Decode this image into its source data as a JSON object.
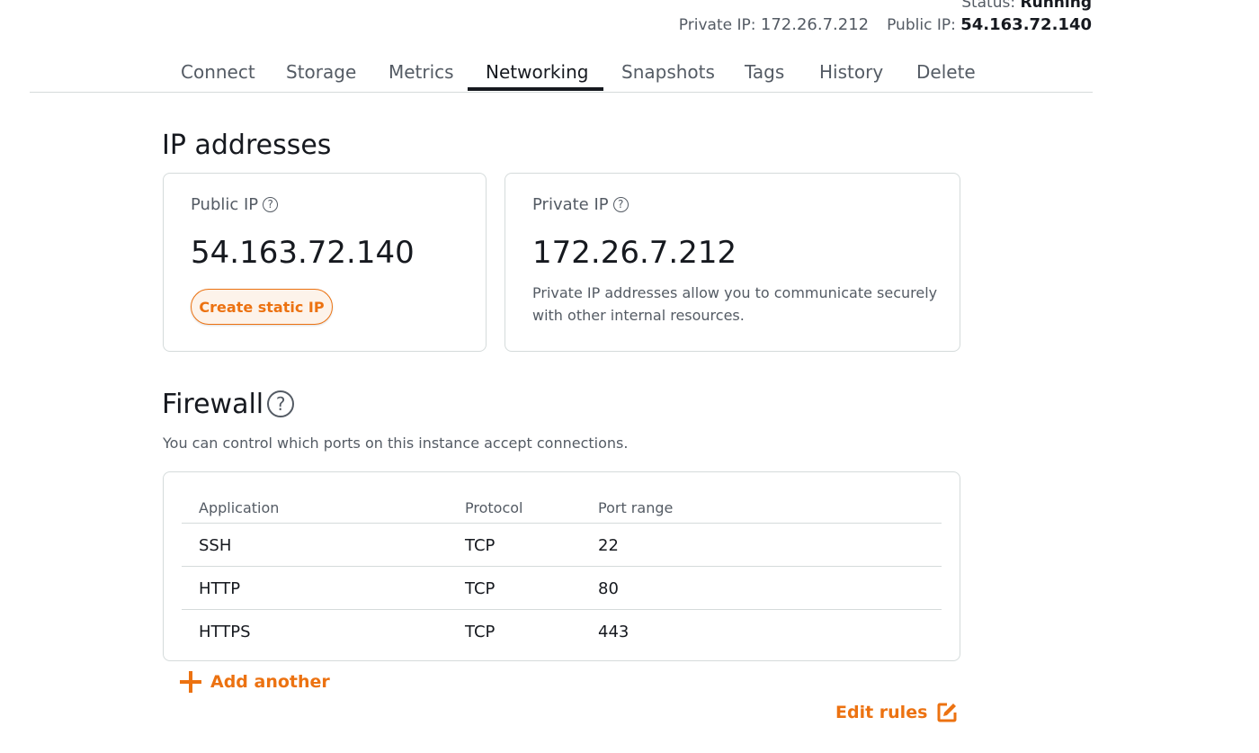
{
  "header": {
    "status_label": "Status:",
    "status_value": "Running",
    "private_ip_label": "Private IP:",
    "private_ip_value": "172.26.7.212",
    "public_ip_label": "Public IP:",
    "public_ip_value": "54.163.72.140"
  },
  "tabs": [
    {
      "label": "Connect",
      "active": false
    },
    {
      "label": "Storage",
      "active": false
    },
    {
      "label": "Metrics",
      "active": false
    },
    {
      "label": "Networking",
      "active": true
    },
    {
      "label": "Snapshots",
      "active": false
    },
    {
      "label": "Tags",
      "active": false
    },
    {
      "label": "History",
      "active": false
    },
    {
      "label": "Delete",
      "active": false
    }
  ],
  "ip_section": {
    "title": "IP addresses",
    "public": {
      "label": "Public IP",
      "help_icon": "?",
      "value": "54.163.72.140",
      "button": "Create static IP"
    },
    "private": {
      "label": "Private IP",
      "help_icon": "?",
      "value": "172.26.7.212",
      "description": "Private IP addresses allow you to communicate securely with other internal resources."
    }
  },
  "firewall": {
    "title": "Firewall",
    "help_icon": "?",
    "description": "You can control which ports on this instance accept connections.",
    "columns": [
      "Application",
      "Protocol",
      "Port range"
    ],
    "rows": [
      [
        "SSH",
        "TCP",
        "22"
      ],
      [
        "HTTP",
        "TCP",
        "80"
      ],
      [
        "HTTPS",
        "TCP",
        "443"
      ]
    ],
    "add_label": "Add another",
    "edit_label": "Edit rules"
  },
  "colors": {
    "accent": "#ec7211",
    "text": "#16191f",
    "muted": "#545b64",
    "border": "#d5dbdb"
  }
}
